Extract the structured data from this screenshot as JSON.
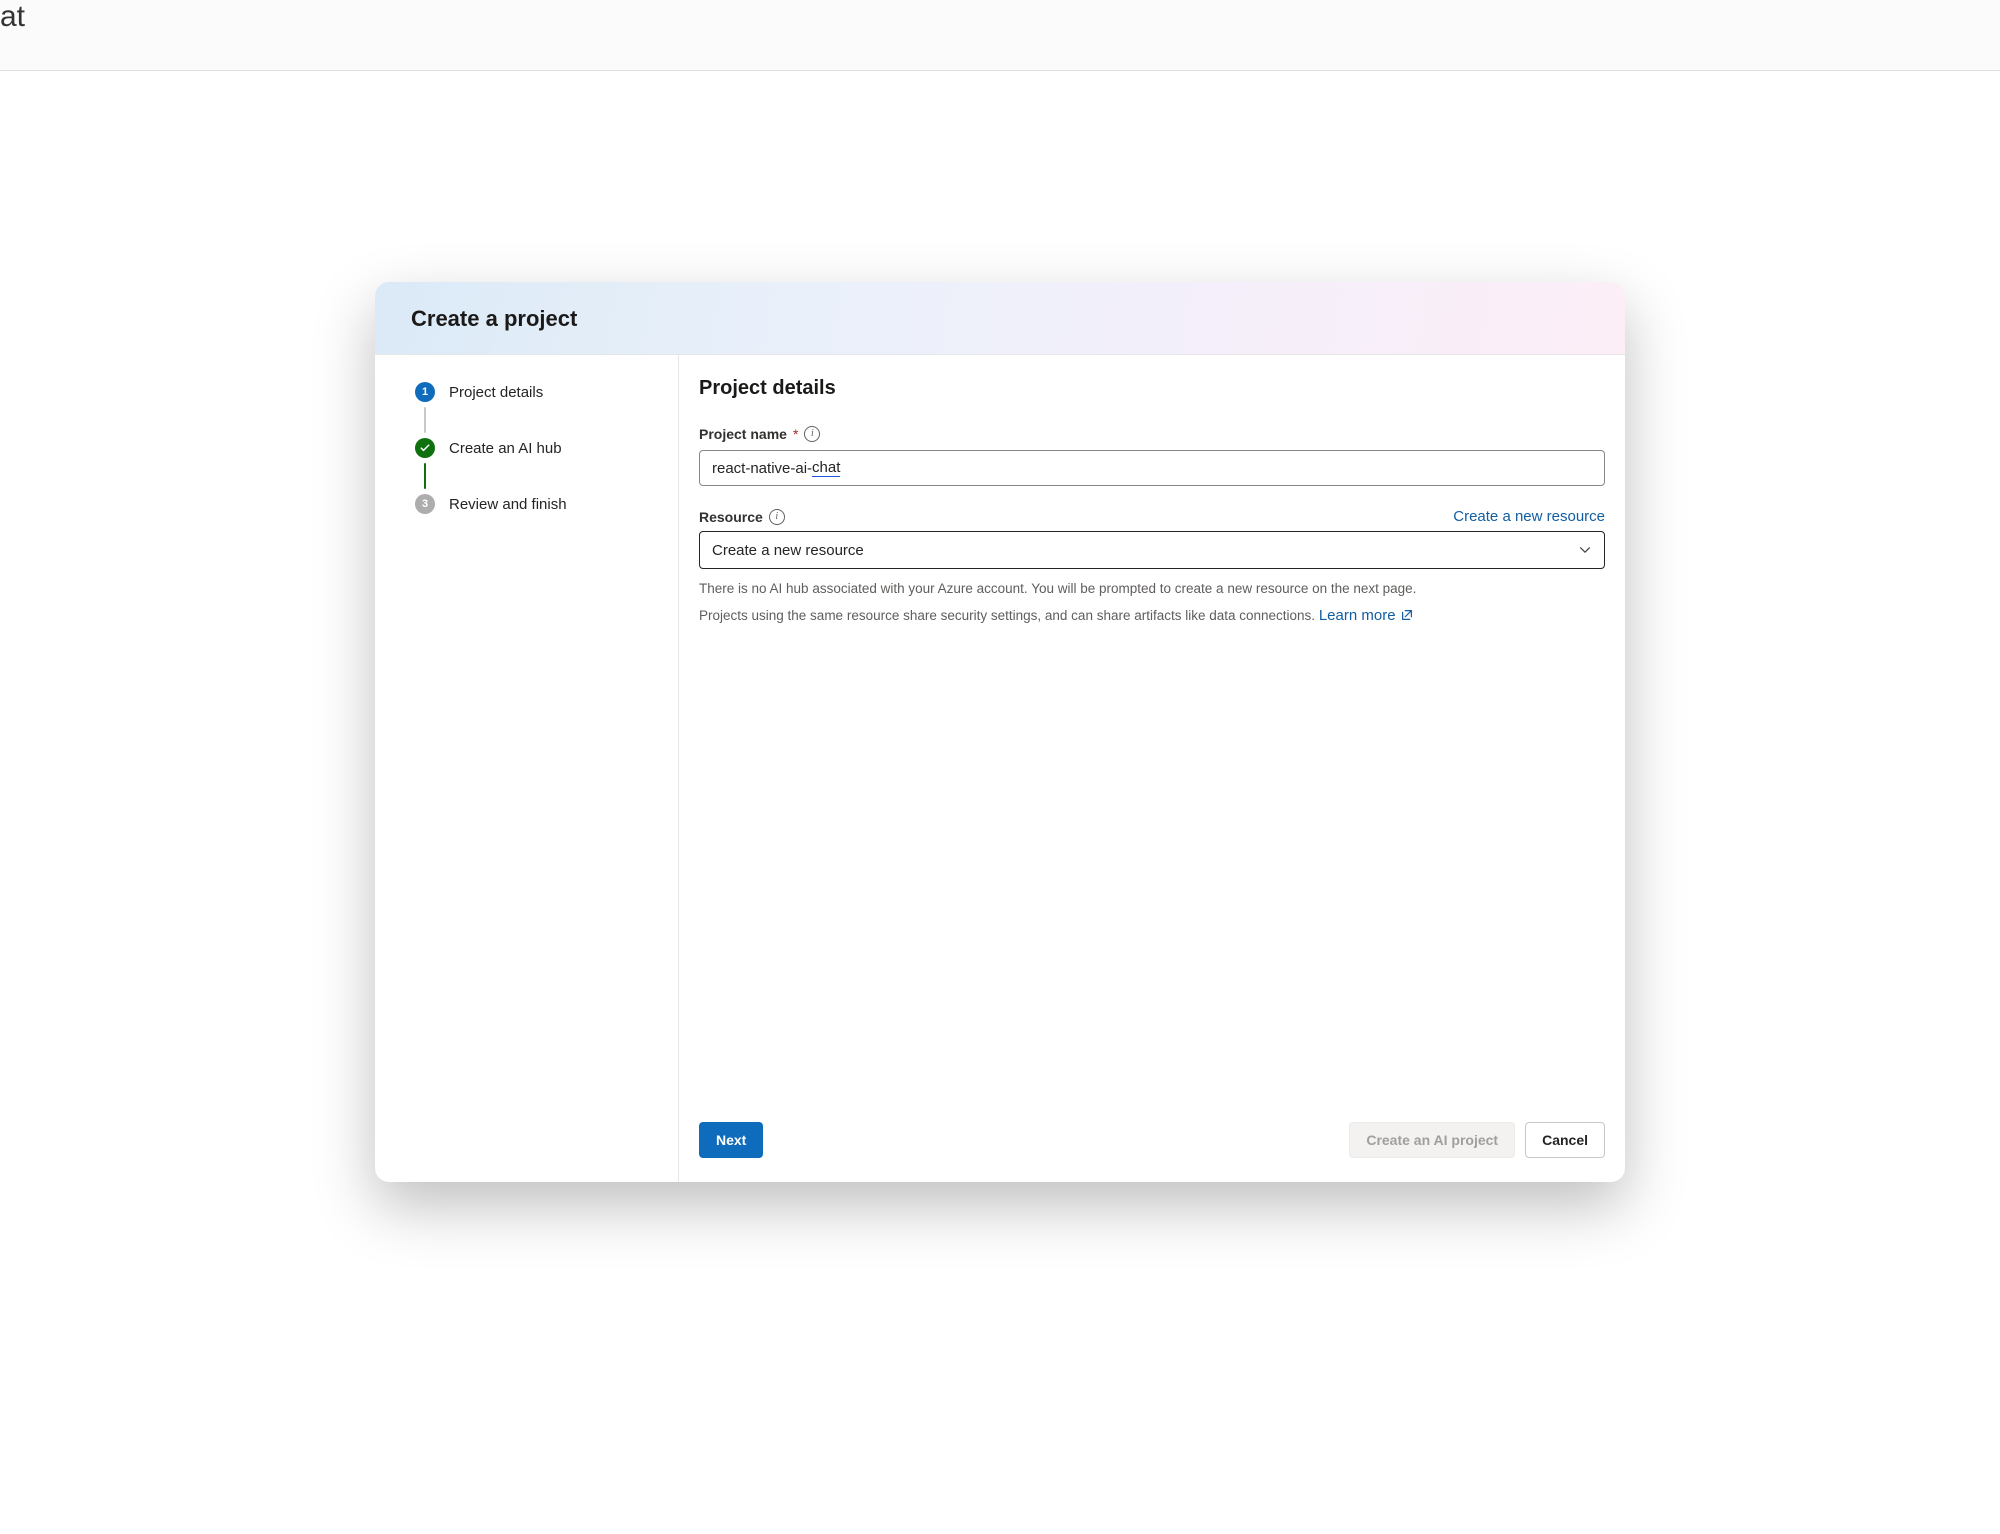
{
  "modal": {
    "title": "Create a project"
  },
  "steps": {
    "s1": {
      "num": "1",
      "label": "Project details"
    },
    "s2": {
      "label": "Create an AI hub"
    },
    "s3": {
      "num": "3",
      "label": "Review and finish"
    }
  },
  "content": {
    "heading": "Project details",
    "projectName": {
      "label": "Project name",
      "value_prefix": "react-native-ai-",
      "value_suffix": "chat"
    },
    "resource": {
      "label": "Resource",
      "createLink": "Create a new resource",
      "selected": "Create a new resource",
      "helper1": "There is no AI hub associated with your Azure account. You will be prompted to create a new resource on the next page.",
      "helper2_prefix": "Projects using the same resource share security settings, and can share artifacts like data connections. ",
      "learnMore": "Learn more"
    }
  },
  "footer": {
    "next": "Next",
    "createProject": "Create an AI project",
    "cancel": "Cancel"
  }
}
